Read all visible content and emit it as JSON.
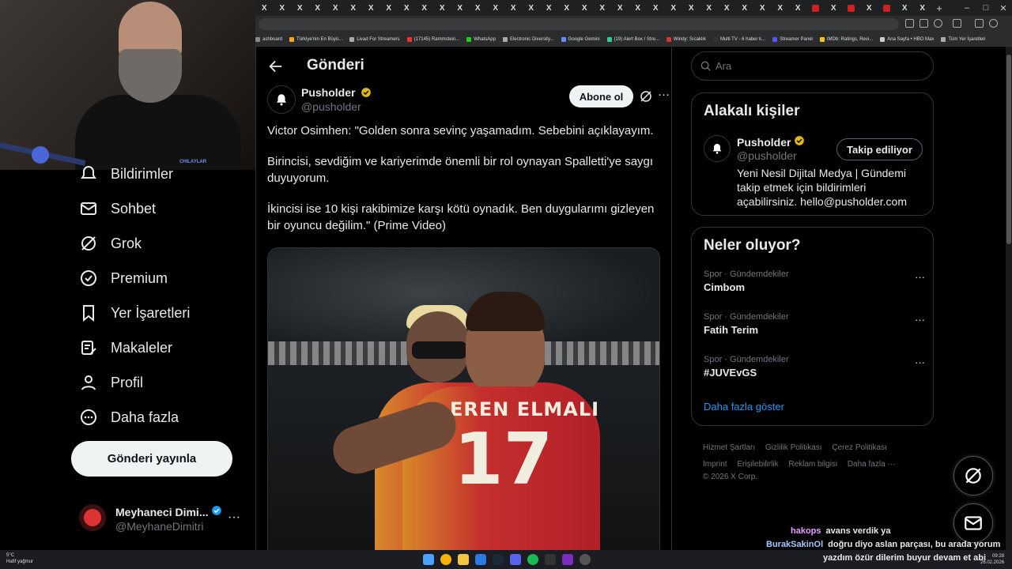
{
  "browser": {
    "tabs": [
      "X",
      "X",
      "X",
      "X",
      "X",
      "X",
      "X",
      "X",
      "X",
      "X",
      "X",
      "X",
      "X",
      "X",
      "X",
      "X",
      "X",
      "X",
      "X",
      "X",
      "X",
      "X",
      "X",
      "X",
      "X",
      "X",
      "X",
      "X",
      "X",
      "X",
      "X",
      "X",
      "X",
      "X",
      "X",
      "X",
      "X",
      "X"
    ],
    "bookmarks": [
      {
        "label": "ashboard",
        "color": "#888"
      },
      {
        "label": "Türkiye'nin En Büyü...",
        "color": "#f5a623"
      },
      {
        "label": "Livad For Streamers",
        "color": "#aaa"
      },
      {
        "label": "(17145) Rammstein...",
        "color": "#e33"
      },
      {
        "label": "WhatsApp",
        "color": "#2c2"
      },
      {
        "label": "Electronic Diversity...",
        "color": "#aaa"
      },
      {
        "label": "Google Gemini",
        "color": "#6a8cff"
      },
      {
        "label": "(19) Alert Box / Stre...",
        "color": "#3c9"
      },
      {
        "label": "Windy: Sıcaklık",
        "color": "#d33"
      },
      {
        "label": "Multi TV - 6 haber k...",
        "color": "#333"
      },
      {
        "label": "Streamer Panel",
        "color": "#55f"
      },
      {
        "label": "IMDb: Ratings, Revi...",
        "color": "#f5c518"
      },
      {
        "label": "Ana Sayfa • HBO Max",
        "color": "#ccc"
      },
      {
        "label": "Tüm Yer İşaretleri",
        "color": "#aaa"
      }
    ]
  },
  "webcam": {
    "logo_text": "CHILAYLAR"
  },
  "nav": {
    "items": [
      {
        "label": "Bildirimler",
        "icon": "bell-icon"
      },
      {
        "label": "Sohbet",
        "icon": "mail-icon"
      },
      {
        "label": "Grok",
        "icon": "grok-icon"
      },
      {
        "label": "Premium",
        "icon": "premium-icon"
      },
      {
        "label": "Yer İşaretleri",
        "icon": "bookmark-icon"
      },
      {
        "label": "Makaleler",
        "icon": "article-icon"
      },
      {
        "label": "Profil",
        "icon": "profile-icon"
      },
      {
        "label": "Daha fazla",
        "icon": "more-circle-icon"
      }
    ],
    "post_button": "Gönderi yayınla",
    "user": {
      "name": "Meyhaneci Dimi...",
      "handle": "@MeyhaneDimitri"
    }
  },
  "main": {
    "title": "Gönderi",
    "author": {
      "name": "Pusholder",
      "handle": "@pusholder"
    },
    "subscribe_label": "Abone ol",
    "paragraphs": [
      "Victor Osimhen: \"Golden sonra sevinç yaşamadım. Sebebini açıklayayım.",
      "Birincisi, sevdiğim ve kariyerimde önemli bir rol oynayan Spalletti'ye saygı duyuyorum.",
      "İkincisi ise 10 kişi rakibimize karşı kötü oynadık. Ben duygularımı gizleyen bir oyuncu değilim.\" (Prime Video)"
    ],
    "media": {
      "shirt_name": "EREN ELMALI",
      "shirt_number": "17"
    }
  },
  "right": {
    "search_placeholder": "Ara",
    "related": {
      "title": "Alakalı kişiler",
      "name": "Pusholder",
      "handle": "@pusholder",
      "follow_label": "Takip ediliyor",
      "bio": "Yeni Nesil Dijital Medya | Gündemi takip etmek için bildirimleri açabilirsiniz. hello@pusholder.com"
    },
    "trends": {
      "title": "Neler oluyor?",
      "items": [
        {
          "category": "Spor · Gündemdekiler",
          "name": "Cimbom"
        },
        {
          "category": "Spor · Gündemdekiler",
          "name": "Fatih Terim"
        },
        {
          "category": "Spor · Gündemdekiler",
          "name": "#JUVEvGS"
        }
      ],
      "show_more": "Daha fazla göster"
    },
    "footer": {
      "links": [
        "Hizmet Şartları",
        "Gizlilik Politikası",
        "Çerez Politikası",
        "Imprint",
        "Erişilebilirlik",
        "Reklam bilgisi",
        "Daha fazla ···"
      ],
      "copyright": "© 2026 X Corp."
    }
  },
  "chat": [
    {
      "user": "hakops",
      "text": "avans verdik ya"
    },
    {
      "user": "BurakSakinOl",
      "text": "doğru diyo aslan parçası, bu arada yorum"
    },
    {
      "user": "",
      "text": "yazdım özür dilerim buyur devam et abi"
    }
  ],
  "taskbar": {
    "weather_temp": "5°C",
    "weather_desc": "Hafif yağmur",
    "time": "09:28",
    "date": "26.02.2026"
  },
  "colors": {
    "accent": "#1d9bf0",
    "verified": "#e2b719",
    "background": "#000000"
  }
}
